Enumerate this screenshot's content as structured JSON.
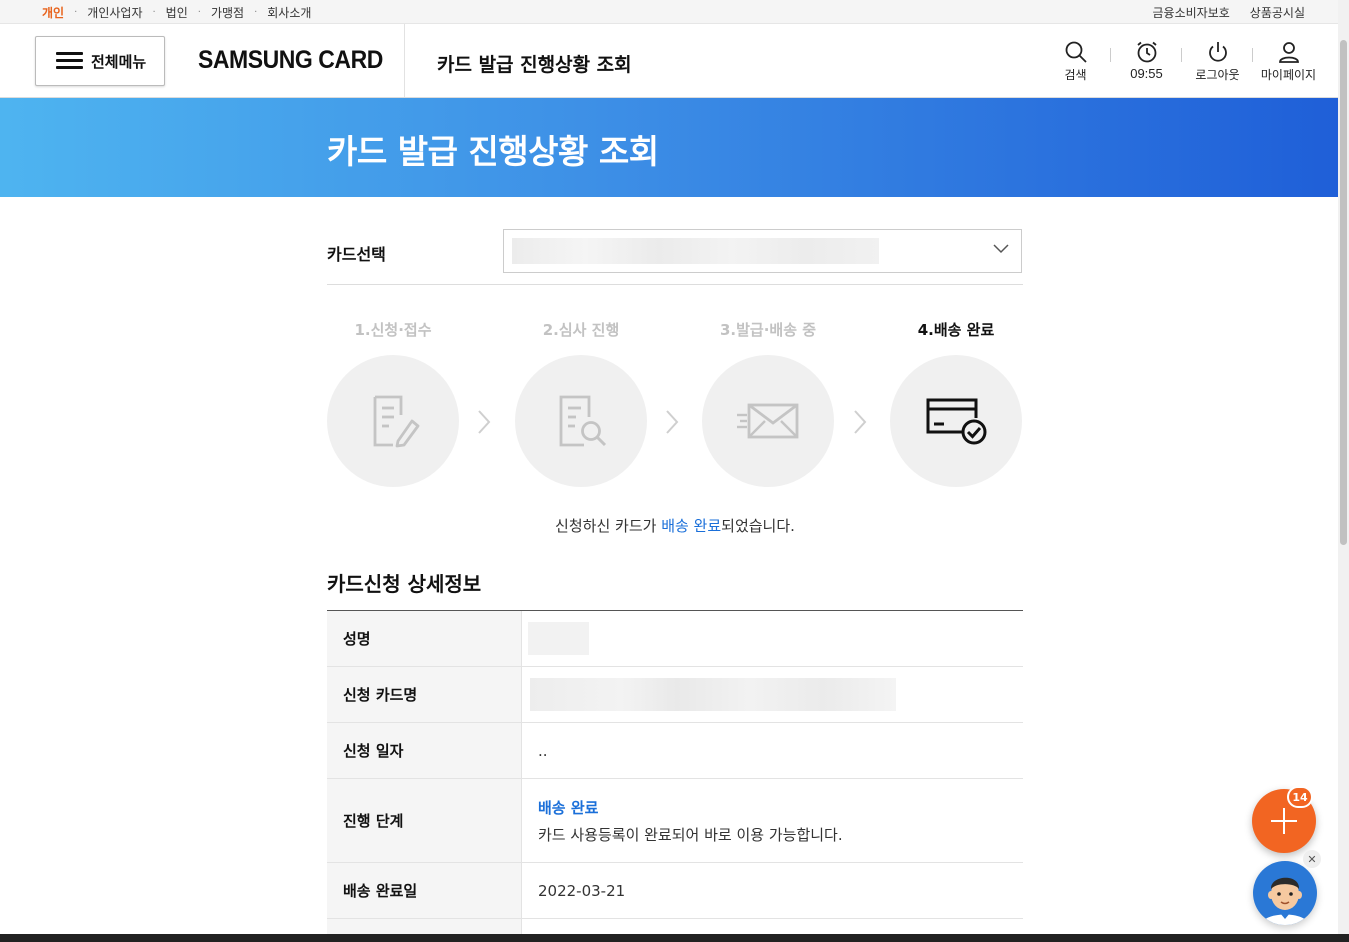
{
  "utilbar": {
    "left_items": [
      "개인",
      "개인사업자",
      "법인",
      "가맹점",
      "회사소개"
    ],
    "right_items": [
      "금융소비자보호",
      "상품공시실"
    ]
  },
  "header": {
    "menu_label": "전체메뉴",
    "logo": "SAMSUNG CARD",
    "title": "카드 발급 진행상황 조회",
    "icons": {
      "search": "검색",
      "timer": "09:55",
      "logout": "로그아웃",
      "mypage": "마이페이지"
    }
  },
  "banner": {
    "title": "카드 발급 진행상황 조회"
  },
  "card_select": {
    "label": "카드선택"
  },
  "steps": [
    {
      "label": "1.신청·접수",
      "icon": "application-form-icon"
    },
    {
      "label": "2.심사 진행",
      "icon": "document-search-icon"
    },
    {
      "label": "3.발급·배송 중",
      "icon": "mail-delivery-icon"
    },
    {
      "label": "4.배송 완료",
      "icon": "card-check-icon"
    }
  ],
  "status_message": {
    "prefix": "신청하신 카드가 ",
    "highlight": "배송 완료",
    "suffix": "되었습니다."
  },
  "detail": {
    "title": "카드신청 상세정보",
    "rows": {
      "name_label": "성명",
      "card_name_label": "신청 카드명",
      "date_label": "신청 일자",
      "date_value": "..",
      "stage_label": "진행 단계",
      "stage_value": "배송 완료",
      "stage_desc": "카드 사용등록이 완료되어 바로 이용 가능합니다.",
      "delivered_label": "배송 완료일",
      "delivered_value": "2022-03-21"
    }
  },
  "floating": {
    "badge_count": "14",
    "close": "✕"
  },
  "colors": {
    "accent": "#f26522",
    "highlight": "#1a6fd9",
    "banner_start": "#4eb4f0",
    "banner_end": "#1f5fd8"
  }
}
